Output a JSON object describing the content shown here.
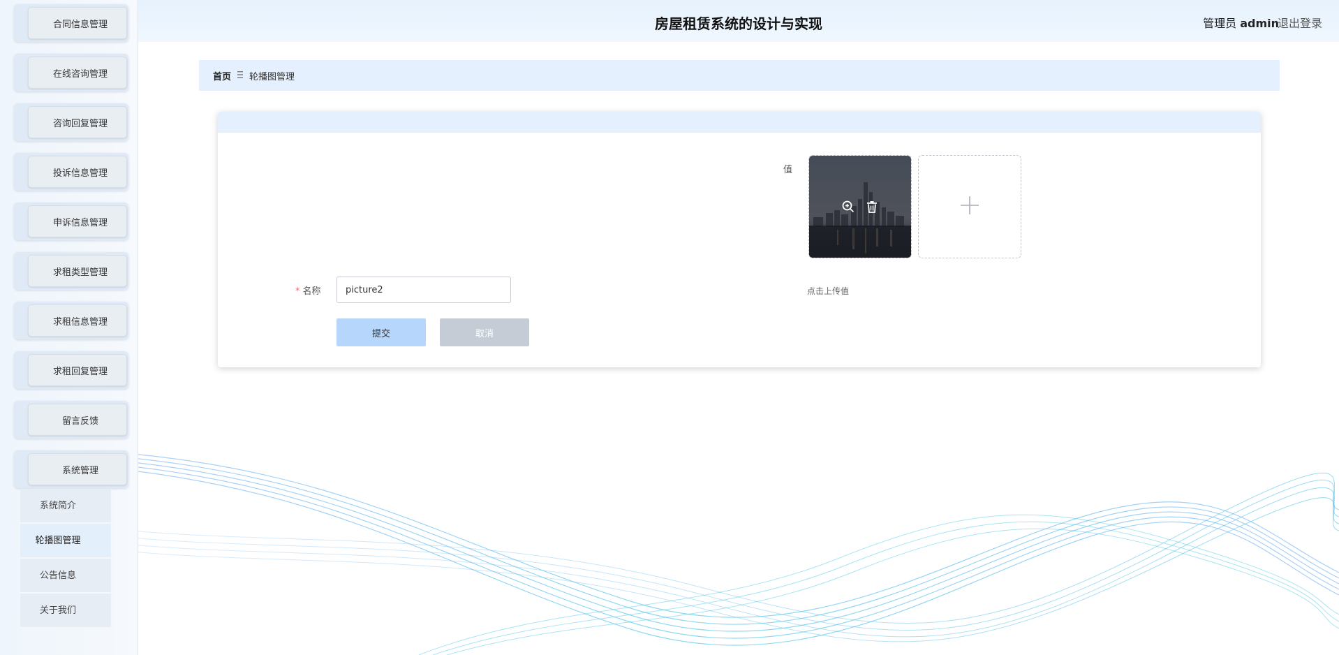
{
  "header": {
    "title": "房屋租赁系统的设计与实现",
    "user_role": "管理员",
    "user_name": "admin",
    "logout_label": "退出登录"
  },
  "sidebar": {
    "menu": [
      {
        "label": "合同信息管理"
      },
      {
        "label": "在线咨询管理"
      },
      {
        "label": "咨询回复管理"
      },
      {
        "label": "投诉信息管理"
      },
      {
        "label": "申诉信息管理"
      },
      {
        "label": "求租类型管理"
      },
      {
        "label": "求租信息管理"
      },
      {
        "label": "求租回复管理"
      },
      {
        "label": "留言反馈"
      },
      {
        "label": "系统管理"
      }
    ],
    "submenu": [
      {
        "label": "系统简介",
        "active": false
      },
      {
        "label": "轮播图管理",
        "active": true
      },
      {
        "label": "公告信息",
        "active": false
      },
      {
        "label": "关于我们",
        "active": false
      }
    ]
  },
  "breadcrumb": {
    "home": "首页",
    "separator_icon": "menu-lines-icon",
    "current": "轮播图管理"
  },
  "form": {
    "value_label": "值",
    "name_label": "名称",
    "name_required_mark": "*",
    "name_value": "picture2",
    "upload_tip": "点击上传值",
    "submit_label": "提交",
    "cancel_label": "取消",
    "thumb_icons": [
      "zoom-in-icon",
      "trash-icon"
    ],
    "upload_icon": "plus-icon"
  },
  "colors": {
    "accent_light": "#e4f0fd",
    "submit_bg": "#b6d6fb",
    "cancel_bg": "#c5ccd5",
    "required": "#f56c6c"
  }
}
